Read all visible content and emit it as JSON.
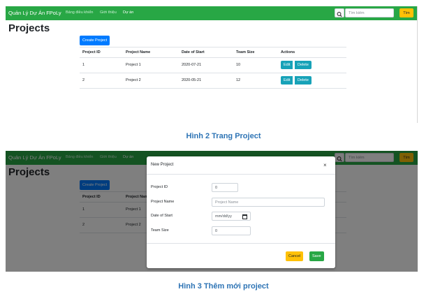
{
  "app": {
    "brand": "Quản Lý Dự Án FPoLy",
    "nav": [
      "Bảng điều khiển",
      "Giới thiệu",
      "Dự án"
    ],
    "search_placeholder": "Tìm kiếm",
    "search_button": "Tìm",
    "page_title": "Projects",
    "create_button": "Create Project"
  },
  "table": {
    "headers": [
      "Project ID",
      "Project Name",
      "Date of Start",
      "Team Size",
      "Actions"
    ],
    "rows": [
      {
        "id": "1",
        "name": "Project 1",
        "date": "2020-07-21",
        "team": "10"
      },
      {
        "id": "2",
        "name": "Project 2",
        "date": "2020-05-21",
        "team": "12"
      }
    ],
    "edit_label": "Edit",
    "delete_label": "Delete"
  },
  "modal": {
    "title": "New Project",
    "close": "×",
    "fields": {
      "id_label": "Project ID",
      "id_value": "0",
      "name_label": "Project Name",
      "name_placeholder": "Project Name",
      "date_label": "Date of Start",
      "date_placeholder": "mm/dd/yy",
      "team_label": "Team Size",
      "team_value": "0"
    },
    "cancel_label": "Cancel",
    "save_label": "Save"
  },
  "captions": {
    "fig2": "Hình 2 Trang Project",
    "fig3": "Hình 3 Thêm mới project"
  },
  "colors": {
    "navbar": "#28a745",
    "primary": "#007bff",
    "info": "#17a2b8",
    "warning": "#ffc107",
    "caption": "#2e74b5"
  },
  "icons": {
    "search": "search-icon",
    "calendar": "calendar-icon",
    "close": "close-icon"
  }
}
